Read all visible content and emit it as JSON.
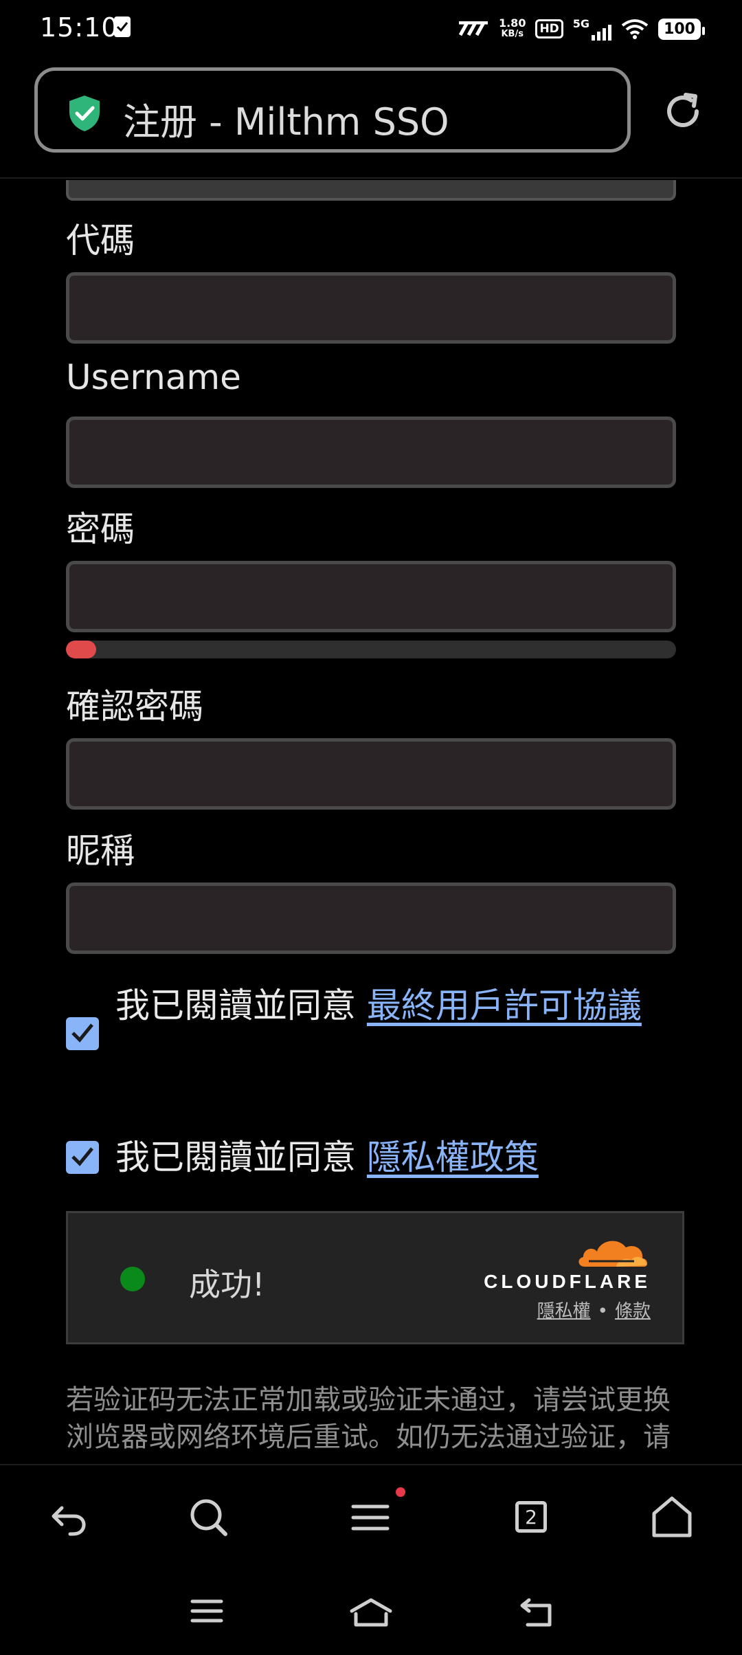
{
  "status_bar": {
    "time": "15:10",
    "net_speed_value": "1.80",
    "net_speed_unit": "KB/s",
    "hd": "HD",
    "network": "5G",
    "battery": "100"
  },
  "browser": {
    "page_title": "注册 - Milthm SSO",
    "tab_count": "2"
  },
  "form": {
    "code_label": "代碼",
    "username_label": "Username",
    "password_label": "密碼",
    "password_strength": 0.05,
    "confirm_password_label": "確認密碼",
    "nickname_label": "昵稱",
    "eula": {
      "prefix": "我已閱讀並同意 ",
      "link": "最終用戶許可協議",
      "checked": true
    },
    "privacy": {
      "prefix": "我已閱讀並同意 ",
      "link": "隱私權政策",
      "checked": true
    }
  },
  "captcha": {
    "status": "成功!",
    "brand": "CLOUDFLARE",
    "privacy_link": "隱私權",
    "separator": "•",
    "terms_link": "條款"
  },
  "notice": "若验证码无法正常加载或验证未通过，请尝试更换浏览器或网络环境后重试。如仍无法通过验证，请",
  "colors": {
    "accent_link": "#8ab4f8",
    "shield_green": "#2fb57a",
    "strength_red": "#e04a4a",
    "success_green": "#0a8a1a",
    "cloudflare_orange": "#f38020"
  },
  "icons": {
    "toolbar": [
      "back-icon",
      "search-icon",
      "menu-icon",
      "tabs-icon",
      "home-icon"
    ],
    "navbar": [
      "recents-icon",
      "home-icon",
      "back-icon"
    ]
  }
}
